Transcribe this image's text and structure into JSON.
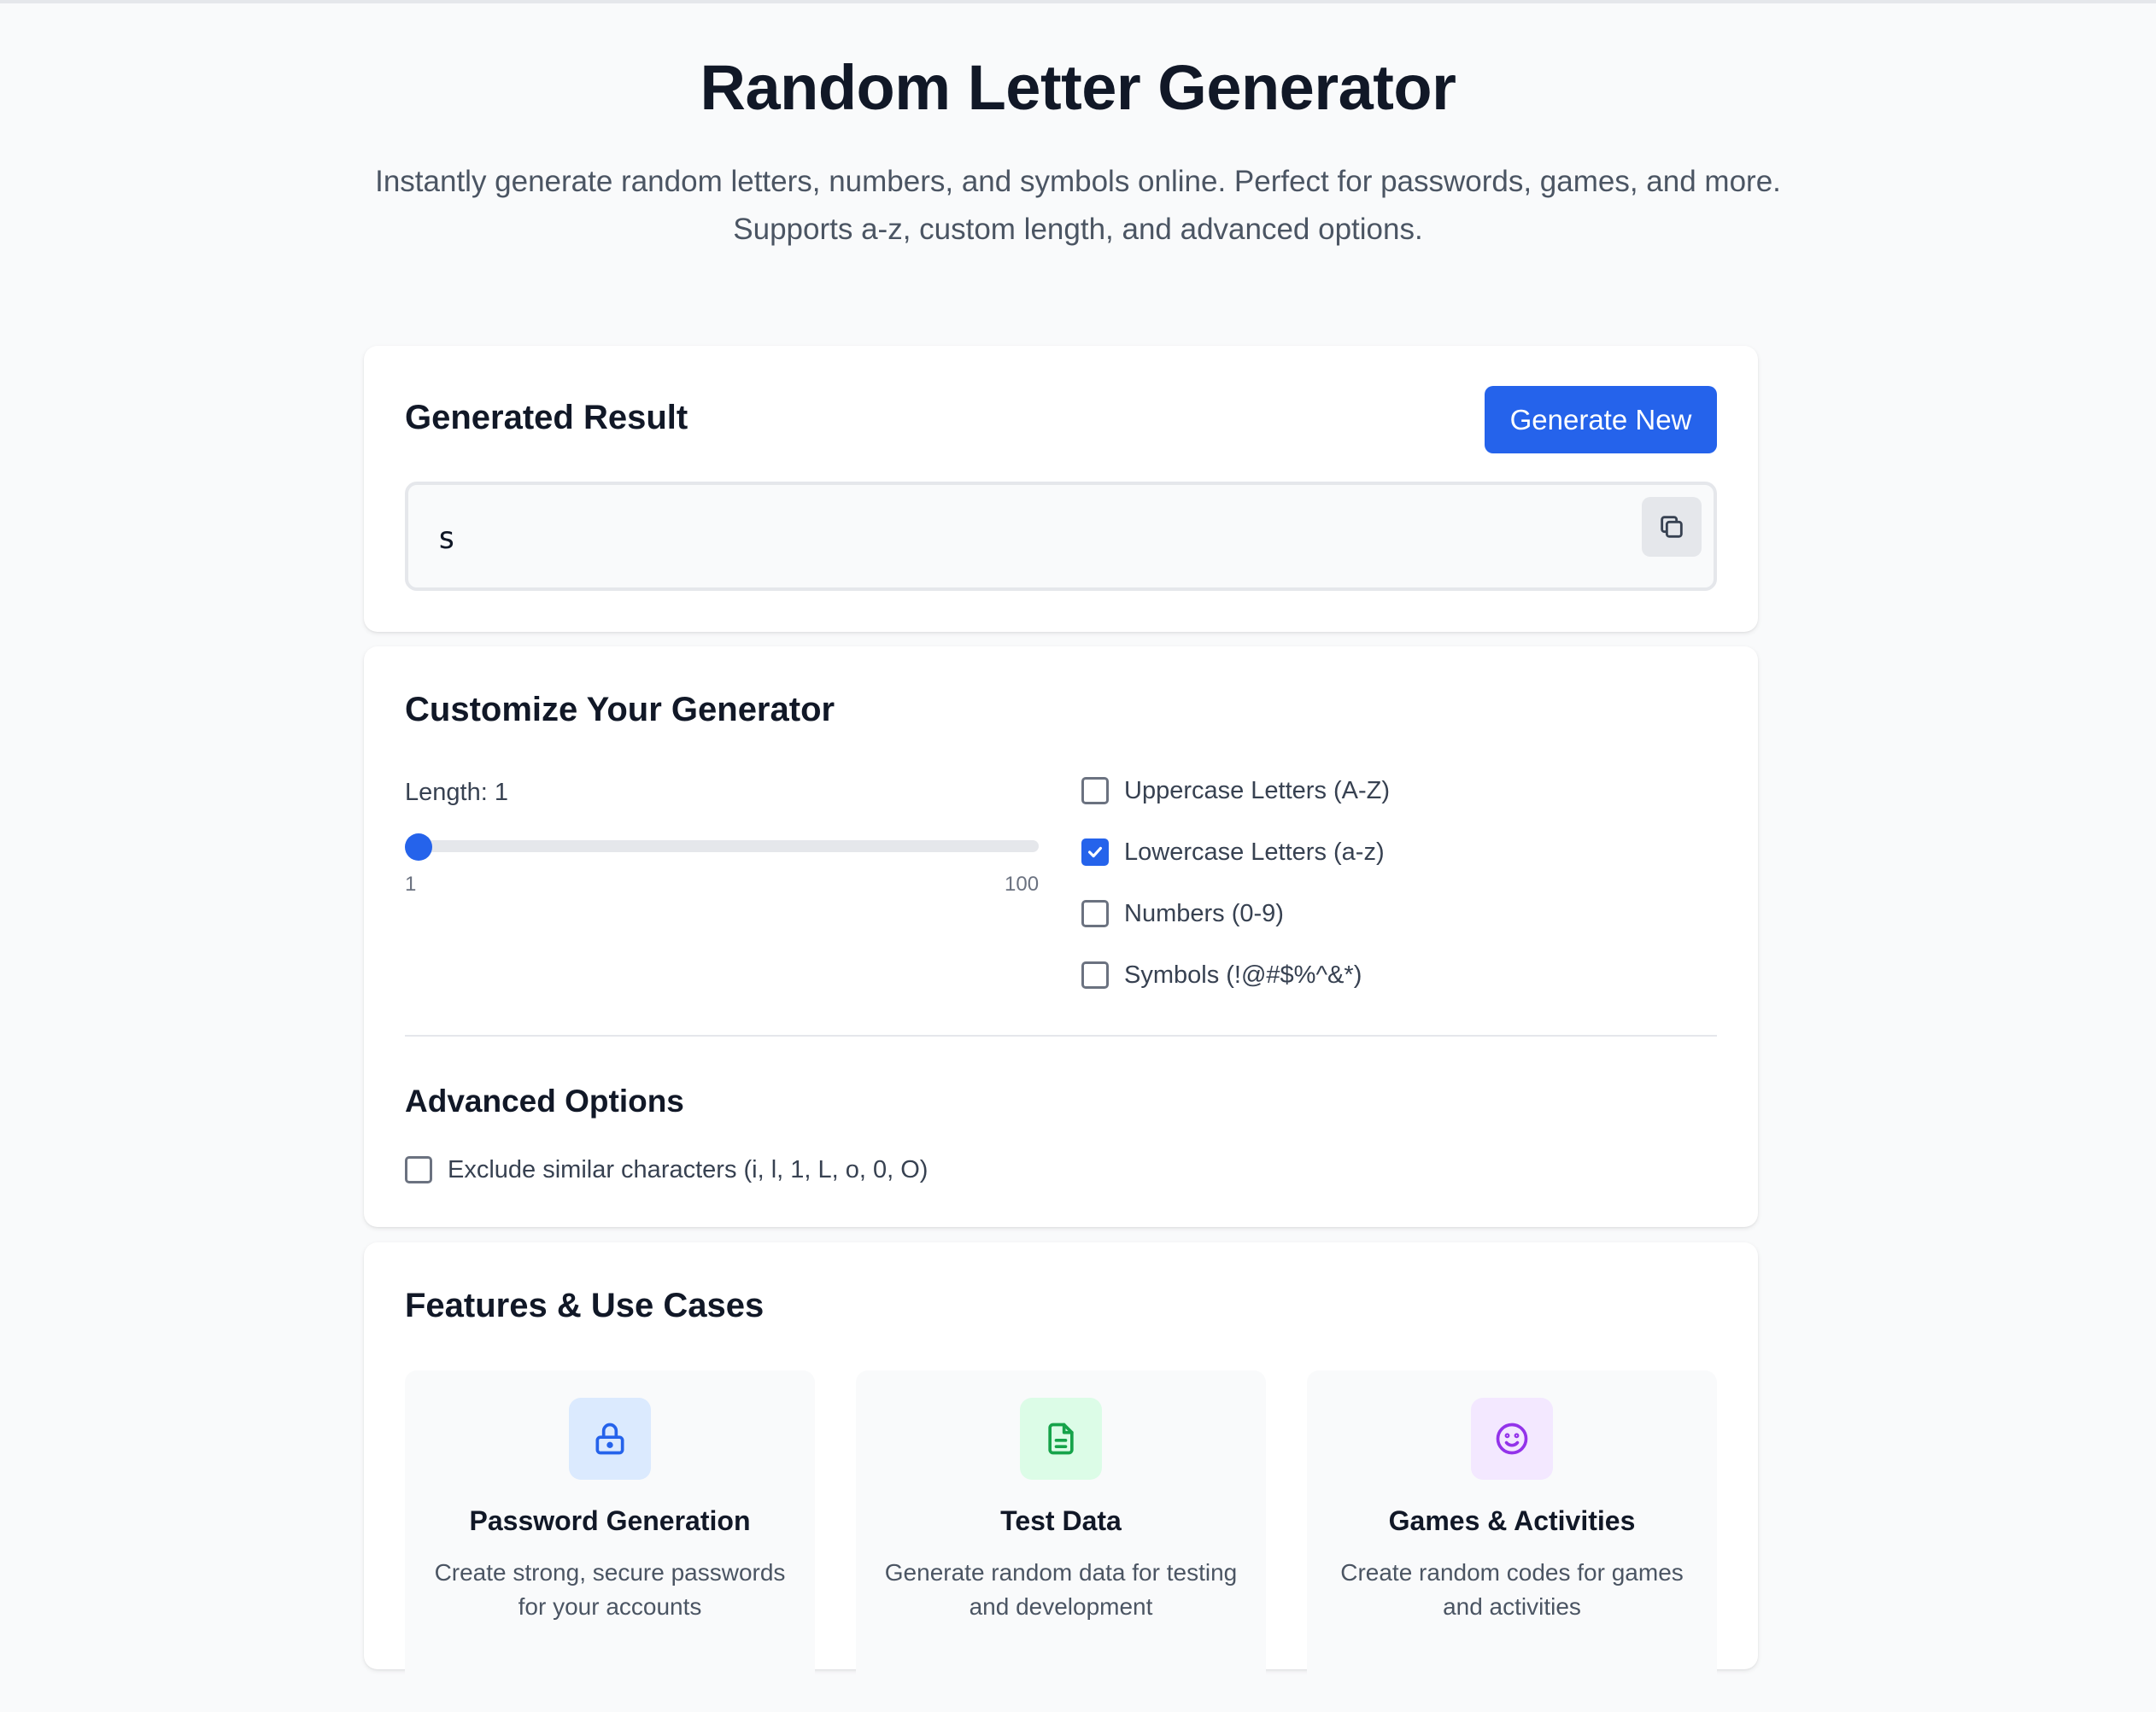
{
  "header": {
    "title": "Random Letter Generator",
    "subtitle": "Instantly generate random letters, numbers, and symbols online. Perfect for passwords, games, and more. Supports a-z, custom length, and advanced options."
  },
  "result": {
    "heading": "Generated Result",
    "generate_label": "Generate New",
    "value": "s",
    "copy_icon": "copy-icon"
  },
  "customize": {
    "heading": "Customize Your Generator",
    "length_label": "Length: 1",
    "slider": {
      "value": 1,
      "min": 1,
      "max": 100,
      "min_label": "1",
      "max_label": "100"
    },
    "options": [
      {
        "label": "Uppercase Letters (A-Z)",
        "checked": false
      },
      {
        "label": "Lowercase Letters (a-z)",
        "checked": true
      },
      {
        "label": "Numbers (0-9)",
        "checked": false
      },
      {
        "label": "Symbols (!@#$%^&*)",
        "checked": false
      }
    ],
    "advanced": {
      "heading": "Advanced Options",
      "exclude_label": "Exclude similar characters (i, l, 1, L, o, 0, O)",
      "exclude_checked": false
    }
  },
  "features": {
    "heading": "Features & Use Cases",
    "items": [
      {
        "title": "Password Generation",
        "desc": "Create strong, secure passwords for your accounts",
        "icon": "lock-icon",
        "color": "#2563eb",
        "bg": "#dbeafe"
      },
      {
        "title": "Test Data",
        "desc": "Generate random data for testing and development",
        "icon": "document-icon",
        "color": "#16a34a",
        "bg": "#dcfce7"
      },
      {
        "title": "Games & Activities",
        "desc": "Create random codes for games and activities",
        "icon": "smiley-icon",
        "color": "#9333ea",
        "bg": "#f3e8ff"
      }
    ]
  },
  "colors": {
    "accent": "#2563eb",
    "background": "#f9fafb",
    "card": "#ffffff"
  }
}
